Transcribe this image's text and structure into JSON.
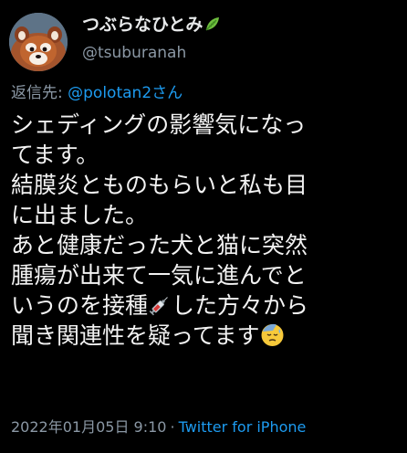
{
  "author": {
    "display_name": "つぶらなひとみ",
    "name_emoji": "herb-leaf-icon",
    "handle": "@tsuburanah",
    "avatar": "red-panda-avatar"
  },
  "reply": {
    "prefix": "返信先:",
    "to": "@polotan2さん"
  },
  "body": {
    "line1": "シェディングの影響気になっ",
    "line2": "てます。",
    "line3": "結膜炎とものもらいと私も目",
    "line4": "に出ました。",
    "line5": "あと健康だった犬と猫に突然",
    "line6": "腫瘍が出来て一気に進んでと",
    "line7a": "いうのを接種",
    "line7_emoji": "syringe-icon",
    "line7b": "した方々から",
    "line8": "聞き関連性を疑ってます",
    "line8_emoji": "sad-sweat-face-icon"
  },
  "meta": {
    "date": "2022年01月05日 9:10",
    "separator": "·",
    "source": "Twitter for iPhone"
  },
  "colors": {
    "background": "#000000",
    "text": "#e7e9ea",
    "secondary": "#8b98a5",
    "link": "#1d9bf0"
  }
}
